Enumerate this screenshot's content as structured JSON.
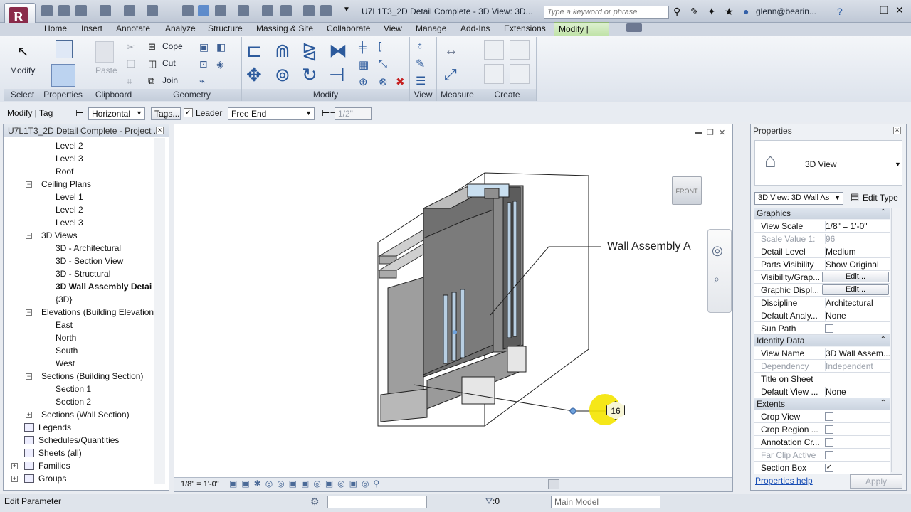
{
  "title": "U7L1T3_2D Detail Complete - 3D View: 3D...",
  "search": {
    "placeholder": "Type a keyword or phrase"
  },
  "user": "glenn@bearin...",
  "tabs": [
    "Home",
    "Insert",
    "Annotate",
    "Analyze",
    "Structure",
    "Massing & Site",
    "Collaborate",
    "View",
    "Manage",
    "Add-Ins",
    "Extensions",
    "Modify | Tag"
  ],
  "ribbon": {
    "select": {
      "title": "Select",
      "modify": "Modify"
    },
    "properties": {
      "title": "Properties"
    },
    "clipboard": {
      "title": "Clipboard",
      "paste": "Paste"
    },
    "geometry": {
      "title": "Geometry",
      "cope": "Cope",
      "cut": "Cut",
      "join": "Join"
    },
    "modify": {
      "title": "Modify"
    },
    "view": {
      "title": "View"
    },
    "measure": {
      "title": "Measure"
    },
    "create": {
      "title": "Create"
    }
  },
  "optionsbar": {
    "context": "Modify | Tag",
    "orientation": "Horizontal",
    "tags_button": "Tags...",
    "leader_label": "Leader",
    "leader_checked": true,
    "end_mode": "Free End",
    "length": "1/2\""
  },
  "browser": {
    "title": "U7L1T3_2D Detail Complete - Project ...",
    "items": [
      {
        "label": "Level 2",
        "level": 2
      },
      {
        "label": "Level 3",
        "level": 2
      },
      {
        "label": "Roof",
        "level": 2
      },
      {
        "label": "Ceiling Plans",
        "level": 1
      },
      {
        "label": "Level 1",
        "level": 2
      },
      {
        "label": "Level 2",
        "level": 2
      },
      {
        "label": "Level 3",
        "level": 2
      },
      {
        "label": "3D Views",
        "level": 1
      },
      {
        "label": "3D - Architectural",
        "level": 2
      },
      {
        "label": "3D - Section View",
        "level": 2
      },
      {
        "label": "3D - Structural",
        "level": 2
      },
      {
        "label": "3D Wall Assembly Detai",
        "level": 2,
        "selected": true
      },
      {
        "label": "{3D}",
        "level": 2
      },
      {
        "label": "Elevations (Building Elevation",
        "level": 1
      },
      {
        "label": "East",
        "level": 2
      },
      {
        "label": "North",
        "level": 2
      },
      {
        "label": "South",
        "level": 2
      },
      {
        "label": "West",
        "level": 2
      },
      {
        "label": "Sections (Building Section)",
        "level": 1
      },
      {
        "label": "Section 1",
        "level": 2
      },
      {
        "label": "Section 2",
        "level": 2
      },
      {
        "label": "Sections (Wall Section)",
        "level": 1
      },
      {
        "label": "Legends",
        "level": 0
      },
      {
        "label": "Schedules/Quantities",
        "level": 0
      },
      {
        "label": "Sheets (all)",
        "level": 0
      },
      {
        "label": "Families",
        "level": 0
      },
      {
        "label": "Groups",
        "level": 0
      }
    ]
  },
  "view": {
    "annotation": "Wall Assembly A",
    "tag_number": "16",
    "viewcube_face": "FRONT",
    "scale": "1/8\" = 1'-0\""
  },
  "properties": {
    "title": "Properties",
    "type_name": "3D View",
    "selector": "3D View: 3D Wall As",
    "edit_type": "Edit Type",
    "groups": [
      {
        "name": "Graphics",
        "rows": [
          {
            "k": "View Scale",
            "v": "1/8\" = 1'-0\""
          },
          {
            "k": "Scale Value    1:",
            "v": "96",
            "dim": true
          },
          {
            "k": "Detail Level",
            "v": "Medium"
          },
          {
            "k": "Parts Visibility",
            "v": "Show Original"
          },
          {
            "k": "Visibility/Grap...",
            "button": "Edit..."
          },
          {
            "k": "Graphic Displ...",
            "button": "Edit..."
          },
          {
            "k": "Discipline",
            "v": "Architectural"
          },
          {
            "k": "Default Analy...",
            "v": "None"
          },
          {
            "k": "Sun Path",
            "check": false
          }
        ]
      },
      {
        "name": "Identity Data",
        "rows": [
          {
            "k": "View Name",
            "v": "3D Wall Assem..."
          },
          {
            "k": "Dependency",
            "v": "Independent",
            "dim": true
          },
          {
            "k": "Title on Sheet",
            "v": ""
          },
          {
            "k": "Default View ...",
            "v": "None"
          }
        ]
      },
      {
        "name": "Extents",
        "rows": [
          {
            "k": "Crop View",
            "check": false
          },
          {
            "k": "Crop Region ...",
            "check": false
          },
          {
            "k": "Annotation Cr...",
            "check": false
          },
          {
            "k": "Far Clip Active",
            "check": false,
            "dim": true
          },
          {
            "k": "Section Box",
            "check": true
          }
        ]
      }
    ],
    "help_link": "Properties help",
    "apply": "Apply"
  },
  "status": {
    "message": "Edit Parameter",
    "selection_count": ":0",
    "model": "Main Model"
  },
  "colors": {
    "accent_tab": "#bfe2a6",
    "link": "#1a4fb5",
    "tag_highlight": "#f4e400"
  }
}
